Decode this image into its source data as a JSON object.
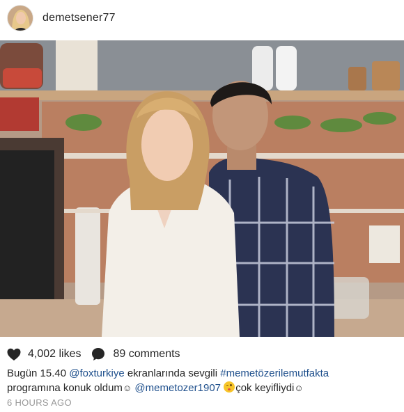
{
  "post": {
    "username": "demetsener77",
    "avatar_icon": "profile-avatar",
    "likes_text": "4,002 likes",
    "comments_text": "89 comments",
    "caption": {
      "text1": "Bugün 15.40 ",
      "mention1": "@foxturkiye",
      "text2": " ekranlarında sevgili ",
      "hashtag": "#memetözerilemutfakta",
      "text3": " programına konuk oldum",
      "smile1": "☺",
      "text4": " ",
      "mention2": "@memetozer1907",
      "text5": " ",
      "text6": "çok keyifliydi",
      "smile2": "☺"
    },
    "timestamp": "6 HOURS AGO",
    "icons": {
      "like": "heart-icon",
      "comment": "comment-bubble-icon",
      "emoji": "winking-kiss-emoji"
    }
  }
}
